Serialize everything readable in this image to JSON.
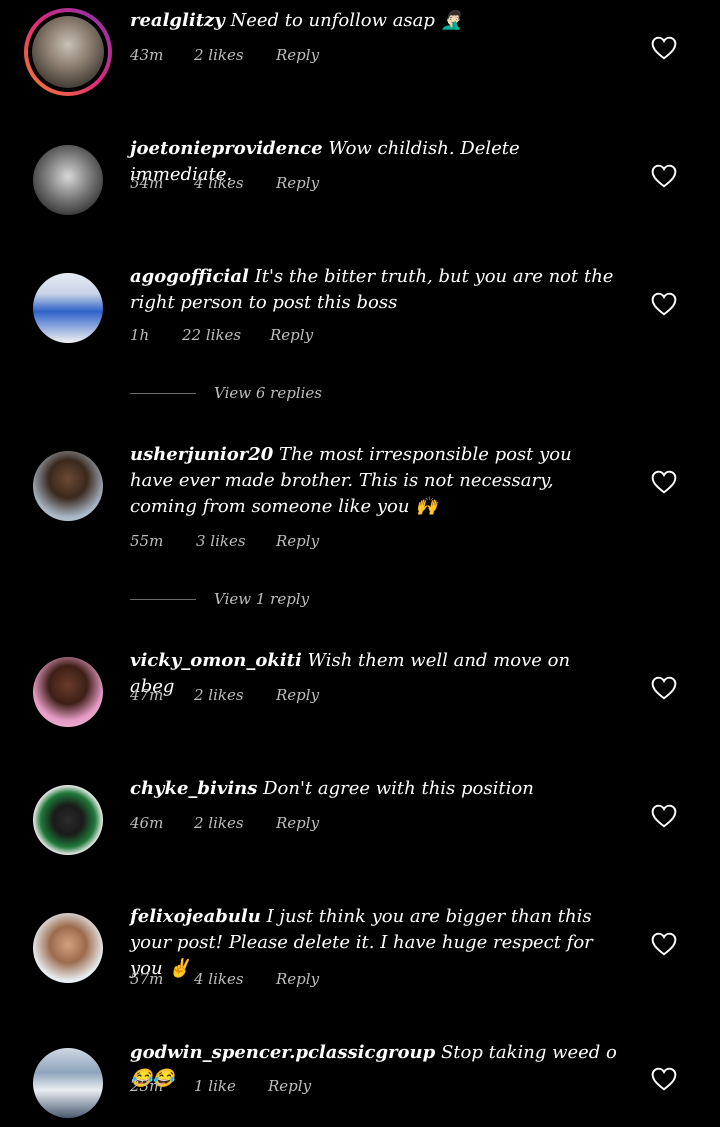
{
  "comments": [
    {
      "username": "realglitzy",
      "text": "Need to unfollow asap 🤦🏻‍♂️",
      "time": "43m",
      "likes": "2 likes",
      "reply": "Reply"
    },
    {
      "username": "joetonieprovidence",
      "text": "Wow childish.  Delete immediate.",
      "time": "54m",
      "likes": "4 likes",
      "reply": "Reply"
    },
    {
      "username": "agogofficial",
      "text": "It's the bitter truth,  but you are not  the right person to post this boss",
      "time": "1h",
      "likes": "22 likes",
      "reply": "Reply"
    },
    {
      "username": "usherjunior20",
      "text": "The most irresponsible post you have ever made brother.  This is not necessary,  coming from someone like you 🙌",
      "time": "55m",
      "likes": "3 likes",
      "reply": "Reply"
    },
    {
      "username": "vicky_omon_okiti",
      "text": "Wish them well and move on abeg",
      "time": "47m",
      "likes": "2 likes",
      "reply": "Reply"
    },
    {
      "username": "chyke_bivins",
      "text": "Don't agree with this position",
      "time": "46m",
      "likes": "2 likes",
      "reply": "Reply"
    },
    {
      "username": "felixojeabulu",
      "text": "I just think you are bigger than this your post! Please delete it.  I have huge respect for you ✌️",
      "time": "57m",
      "likes": "4 likes",
      "reply": "Reply"
    },
    {
      "username": "godwin_spencer.pclassicgroup",
      "text": "Stop taking weed o😂😂",
      "time": "23m",
      "likes": "1 like",
      "reply": "Reply"
    }
  ],
  "view_replies": [
    "View 6 replies",
    "View 1 reply"
  ],
  "icons": {
    "heart": "heart-outline-icon"
  },
  "colors": {
    "background": "#000000",
    "meta": "#bdbdbd",
    "story_ring": [
      "#f58529",
      "#dd2a7b",
      "#8134af"
    ]
  }
}
